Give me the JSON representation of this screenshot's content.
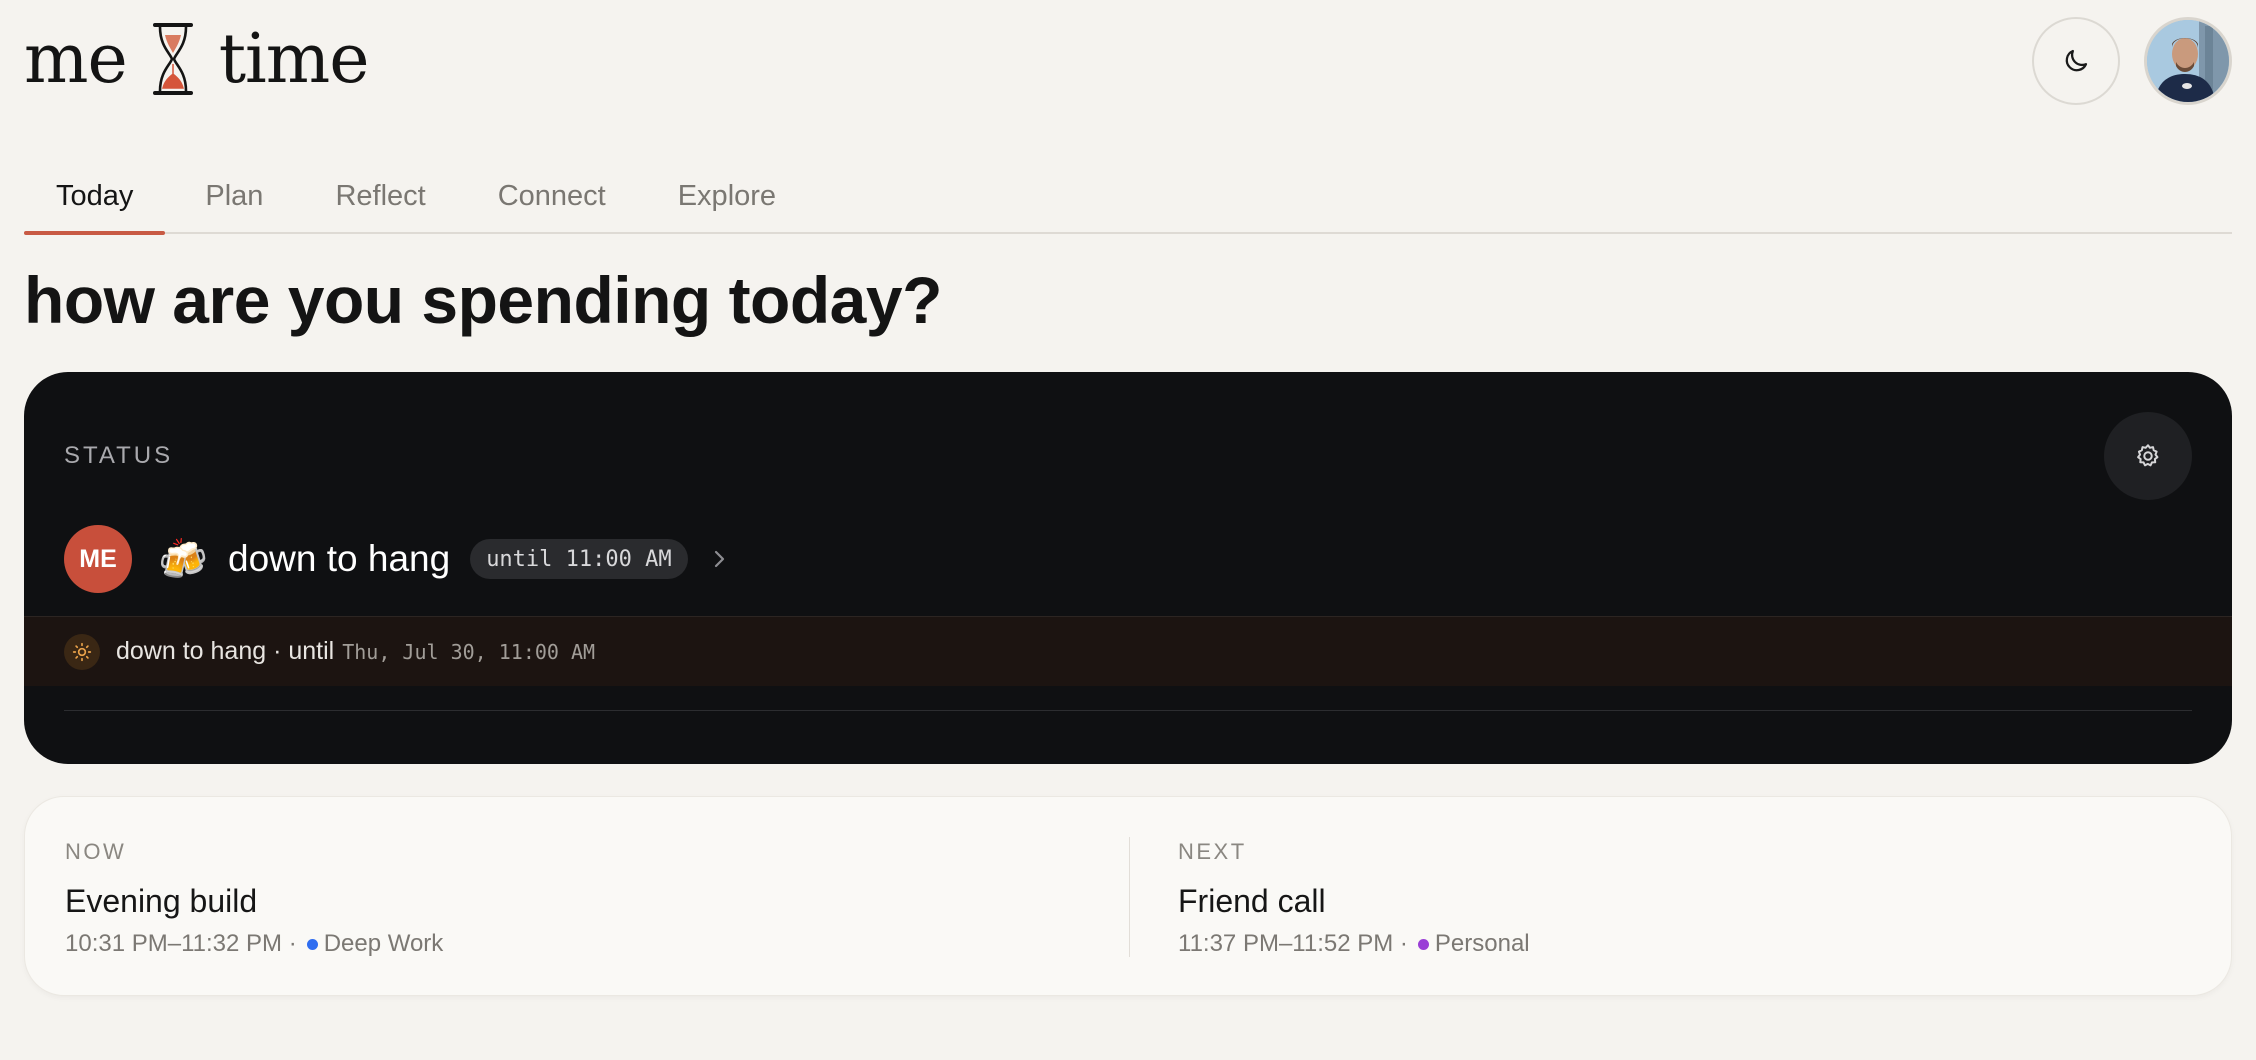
{
  "app": {
    "logo_left": "me",
    "logo_right": "time",
    "accent_color": "#c85a44"
  },
  "header": {
    "theme_icon": "moon-icon",
    "avatar_alt": "user-avatar"
  },
  "tabs": [
    {
      "label": "Today",
      "active": true
    },
    {
      "label": "Plan",
      "active": false
    },
    {
      "label": "Reflect",
      "active": false
    },
    {
      "label": "Connect",
      "active": false
    },
    {
      "label": "Explore",
      "active": false
    }
  ],
  "page": {
    "title": "how are you spending today?"
  },
  "status": {
    "section_label": "STATUS",
    "settings_icon": "gear-icon",
    "user_initials": "ME",
    "emoji": "🍻",
    "text": "down to hang",
    "until_label": "until 11:00 AM",
    "banner_text": "down to hang · until",
    "banner_date": "Thu, Jul 30, 11:00 AM"
  },
  "now": {
    "label": "NOW",
    "title": "Evening build",
    "time": "10:31 PM–11:32 PM ·",
    "category": "Deep Work",
    "category_color": "#2f6df0"
  },
  "next": {
    "label": "NEXT",
    "title": "Friend call",
    "time": "11:37 PM–11:52 PM ·",
    "category": "Personal",
    "category_color": "#9a3fd6"
  }
}
